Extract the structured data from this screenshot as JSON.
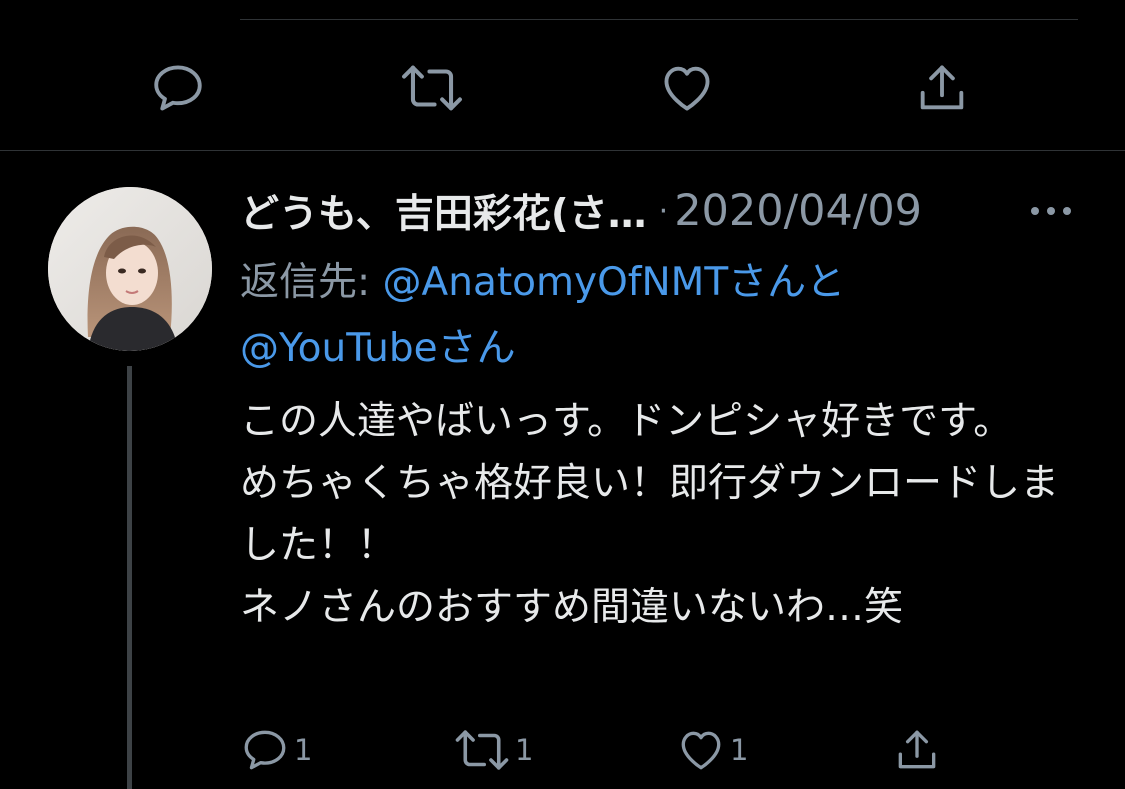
{
  "previous_tweet": {
    "actions": [
      {
        "name": "reply",
        "icon": "reply-icon"
      },
      {
        "name": "retweet",
        "icon": "retweet-icon"
      },
      {
        "name": "like",
        "icon": "heart-icon"
      },
      {
        "name": "share",
        "icon": "share-icon"
      }
    ]
  },
  "tweet": {
    "display_name": "どうも、吉田彩花(さ…",
    "separator": "·",
    "date": "2020/04/09",
    "more_icon": "more-icon",
    "reply_to_label": "返信先: ",
    "reply_to_mention_1": "@AnatomyOfNMTさんと",
    "reply_to_mention_2": "@YouTubeさん",
    "text": "この人達やばいっす。ドンピシャ好きです。\nめちゃくちゃ格好良い！即行ダウンロードしました！！\nネノさんのおすすめ間違いないわ…笑",
    "counts": {
      "replies": "1",
      "retweets": "1",
      "likes": "1"
    }
  },
  "colors": {
    "background": "#000000",
    "text": "#e7e9ea",
    "muted": "#8b98a5",
    "link": "#4a99e9",
    "divider": "#2f3336"
  }
}
